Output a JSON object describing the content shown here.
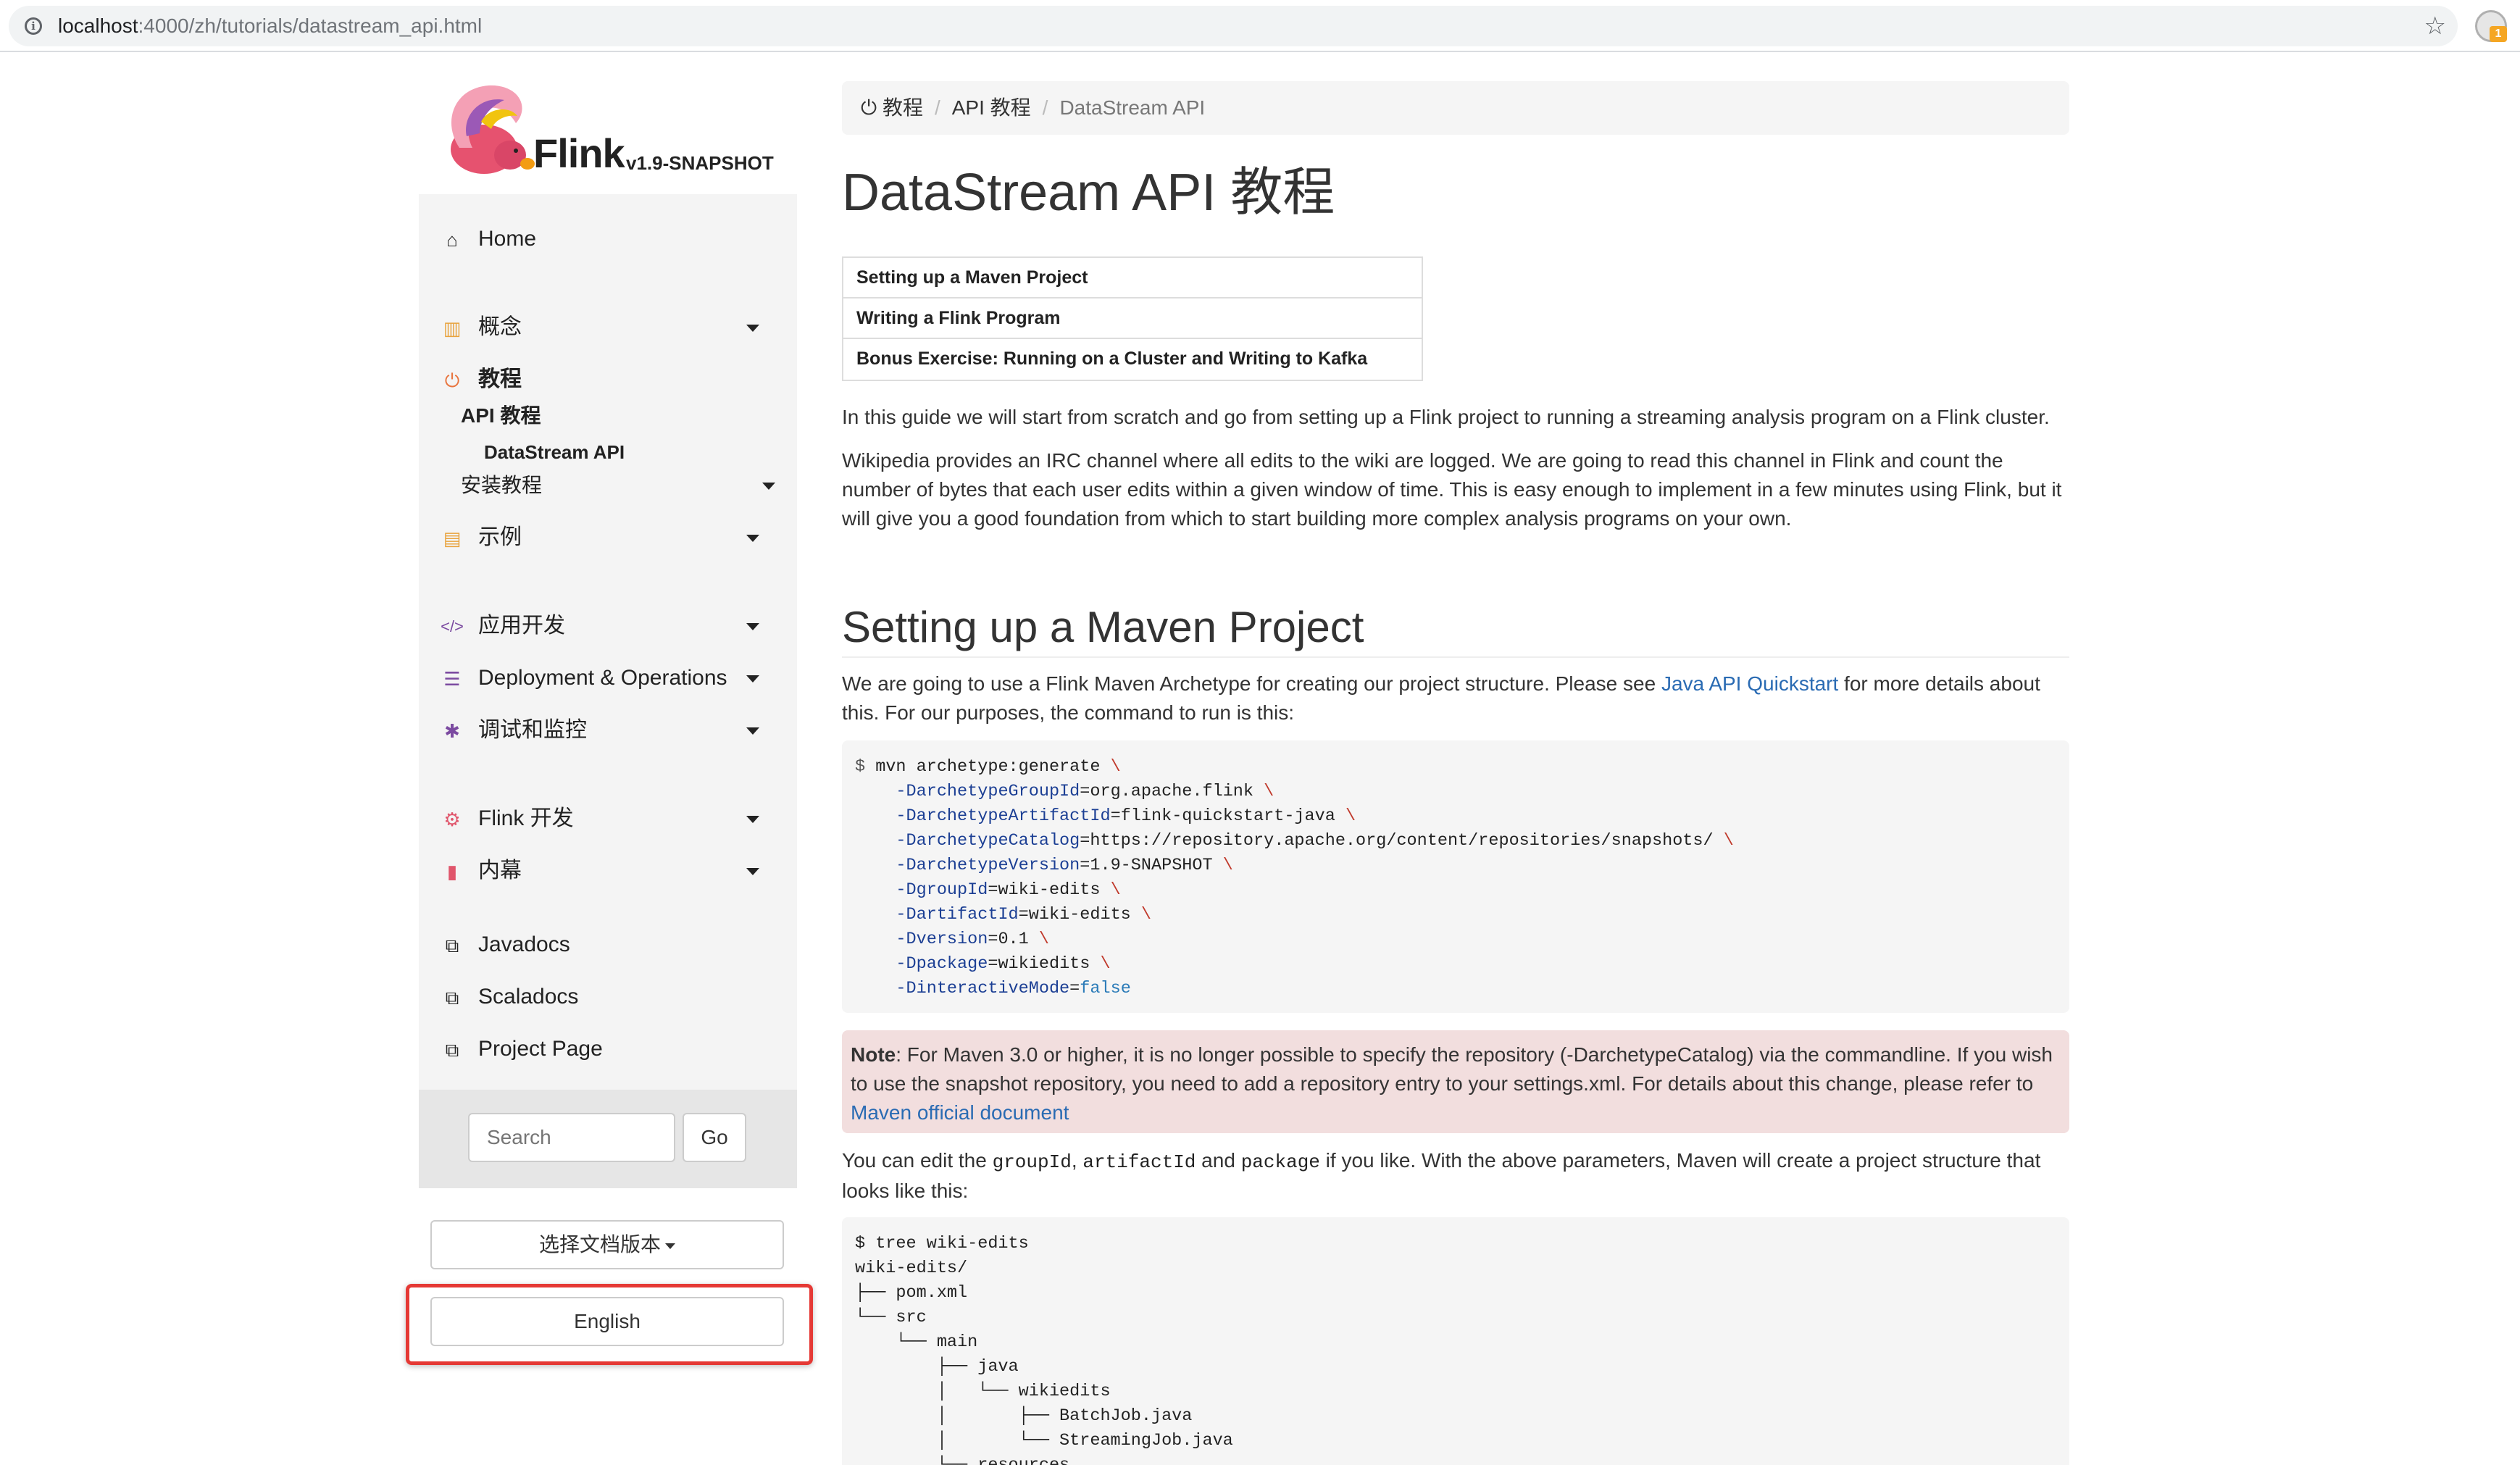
{
  "browser": {
    "url_host": "localhost",
    "url_path": ":4000/zh/tutorials/datastream_api.html",
    "ext_badge": "1"
  },
  "logo": {
    "name": "Flink",
    "version": "v1.9-SNAPSHOT"
  },
  "sidebar": {
    "items": [
      {
        "label": "Home"
      },
      {
        "label": "概念"
      },
      {
        "label": "教程"
      },
      {
        "label": "示例"
      },
      {
        "label": "应用开发"
      },
      {
        "label": "Deployment & Operations"
      },
      {
        "label": "调试和监控"
      },
      {
        "label": "Flink 开发"
      },
      {
        "label": "内幕"
      },
      {
        "label": "Javadocs"
      },
      {
        "label": "Scaladocs"
      },
      {
        "label": "Project Page"
      }
    ],
    "sub_api": "API 教程",
    "sub_datastream": "DataStream API",
    "sub_install": "安装教程",
    "search_placeholder": "Search",
    "go_label": "Go",
    "version_label": "选择文档版本",
    "english_label": "English"
  },
  "breadcrumb": {
    "home": "教程",
    "api": "API 教程",
    "current": "DataStream API"
  },
  "page": {
    "title": "DataStream API 教程",
    "toc": [
      "Setting up a Maven Project",
      "Writing a Flink Program",
      "Bonus Exercise: Running on a Cluster and Writing to Kafka"
    ],
    "intro1": "In this guide we will start from scratch and go from setting up a Flink project to running a streaming analysis program on a Flink cluster.",
    "intro2": "Wikipedia provides an IRC channel where all edits to the wiki are logged. We are going to read this channel in Flink and count the number of bytes that each user edits within a given window of time. This is easy enough to implement in a few minutes using Flink, but it will give you a good foundation from which to start building more complex analysis programs on your own.",
    "h2": "Setting up a Maven Project",
    "maven_before": "We are going to use a Flink Maven Archetype for creating our project structure. Please see ",
    "maven_link": "Java API Quickstart",
    "maven_after": " for more details about this. For our purposes, the command to run is this:",
    "code1": {
      "prompt": "$ ",
      "cmd": "mvn archetype:generate",
      "params": [
        {
          "key": "-DarchetypeGroupId",
          "val": "org.apache.flink"
        },
        {
          "key": "-DarchetypeArtifactId",
          "val": "flink-quickstart-java"
        },
        {
          "key": "-DarchetypeCatalog",
          "val": "https://repository.apache.org/content/repositories/snapshots/"
        },
        {
          "key": "-DarchetypeVersion",
          "val": "1.9-SNAPSHOT"
        },
        {
          "key": "-DgroupId",
          "val": "wiki-edits"
        },
        {
          "key": "-DartifactId",
          "val": "wiki-edits"
        },
        {
          "key": "-Dversion",
          "val": "0.1"
        },
        {
          "key": "-Dpackage",
          "val": "wikiedits"
        },
        {
          "key": "-DinteractiveMode",
          "val": "false"
        }
      ]
    },
    "note_label": "Note",
    "note_text": ": For Maven 3.0 or higher, it is no longer possible to specify the repository (-DarchetypeCatalog) via the commandline. If you wish to use the snapshot repository, you need to add a repository entry to your settings.xml. For details about this change, please refer to ",
    "note_link": "Maven official document",
    "edit_1": "You can edit the ",
    "edit_code1": "groupId",
    "edit_2": ", ",
    "edit_code2": "artifactId",
    "edit_3": " and ",
    "edit_code3": "package",
    "edit_4": " if you like. With the above parameters, Maven will create a project structure that looks like this:",
    "tree_lines": [
      "$ tree wiki-edits",
      "wiki-edits/",
      "├── pom.xml",
      "└── src",
      "    └── main",
      "        ├── java",
      "        │   └── wikiedits",
      "        │       ├── BatchJob.java",
      "        │       └── StreamingJob.java",
      "        └── resources"
    ]
  },
  "colors": {
    "link": "#2a6bb3",
    "note_bg": "#f2dede",
    "highlight": "#e53935"
  }
}
